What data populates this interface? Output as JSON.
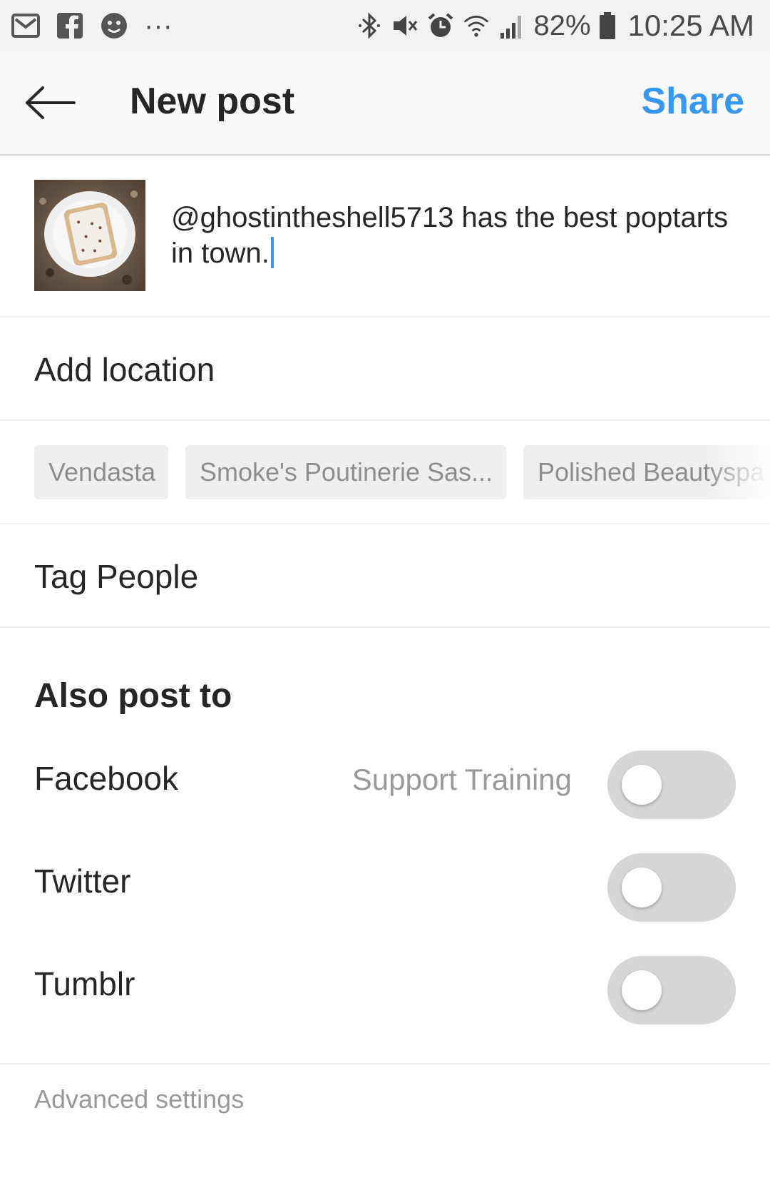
{
  "status_bar": {
    "battery": "82%",
    "time": "10:25 AM",
    "more": "···",
    "icons": [
      "mail-icon",
      "facebook-icon",
      "emoji-icon",
      "bluetooth-icon",
      "mute-icon",
      "alarm-icon",
      "wifi-icon",
      "signal-icon",
      "battery-icon"
    ]
  },
  "header": {
    "title": "New post",
    "share_label": "Share"
  },
  "post": {
    "caption": "@ghostintheshell5713 has the best poptarts in town."
  },
  "location": {
    "label": "Add location",
    "suggestions": [
      "Vendasta",
      "Smoke's Poutinerie Sas...",
      "Polished Beautyspa"
    ]
  },
  "tag_people": {
    "label": "Tag People"
  },
  "also_post_to": {
    "title": "Also post to",
    "items": [
      {
        "label": "Facebook",
        "account": "Support Training",
        "enabled": false
      },
      {
        "label": "Twitter",
        "account": "",
        "enabled": false
      },
      {
        "label": "Tumblr",
        "account": "",
        "enabled": false
      }
    ]
  },
  "advanced": {
    "label": "Advanced settings"
  },
  "colors": {
    "accent": "#3897f0",
    "text": "#262626",
    "muted": "#999999",
    "toggle_off": "#d6d6d6",
    "chip_bg": "#efefef"
  }
}
